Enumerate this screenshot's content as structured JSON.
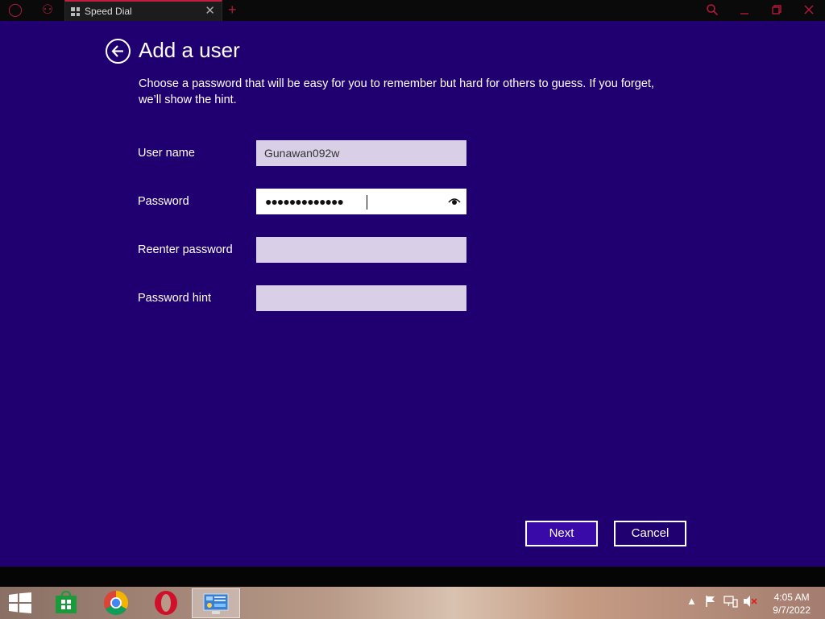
{
  "browser": {
    "tab_title": "Speed Dial",
    "tab_close": "✕",
    "new_tab": "+"
  },
  "dialog": {
    "title": "Add a user",
    "description": "Choose a password that will be easy for you to remember but hard for others to guess. If you forget, we’ll show the hint.",
    "fields": {
      "username_label": "User name",
      "username_value": "Gunawan092w",
      "password_label": "Password",
      "password_dots": "●●●●●●●●●●●●●",
      "reenter_label": "Reenter password",
      "hint_label": "Password hint"
    },
    "buttons": {
      "next": "Next",
      "cancel": "Cancel"
    }
  },
  "taskbar": {
    "time": "4:05 AM",
    "date": "9/7/2022"
  },
  "colors": {
    "background": "#200070",
    "accent": "#3a0aa8",
    "field": "#d9d0e8",
    "browser_accent": "#c0203e"
  }
}
